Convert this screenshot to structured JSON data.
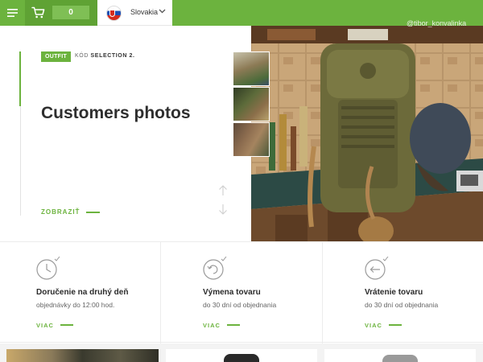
{
  "header": {
    "cart_count": "0",
    "language": "Slovakia"
  },
  "hero": {
    "badge": "OUTFIT",
    "code_prefix": "KÓD",
    "code_value": "SELECTION 2.",
    "title": "Customers photos",
    "link": "ZOBRAZIŤ",
    "photo_handle": "@tibor_konvalinka"
  },
  "services": [
    {
      "title": "Doručenie na druhý deň",
      "subtitle": "objednávky do 12:00 hod.",
      "more": "VIAC",
      "icon": "clock-icon"
    },
    {
      "title": "Výmena tovaru",
      "subtitle": "do 30 dní od objednania",
      "more": "VIAC",
      "icon": "exchange-icon"
    },
    {
      "title": "Vrátenie tovaru",
      "subtitle": "do 30 dní od objednania",
      "more": "VIAC",
      "icon": "return-icon"
    }
  ],
  "colors": {
    "accent": "#6cb33e",
    "accent_dark": "#5fa234"
  }
}
